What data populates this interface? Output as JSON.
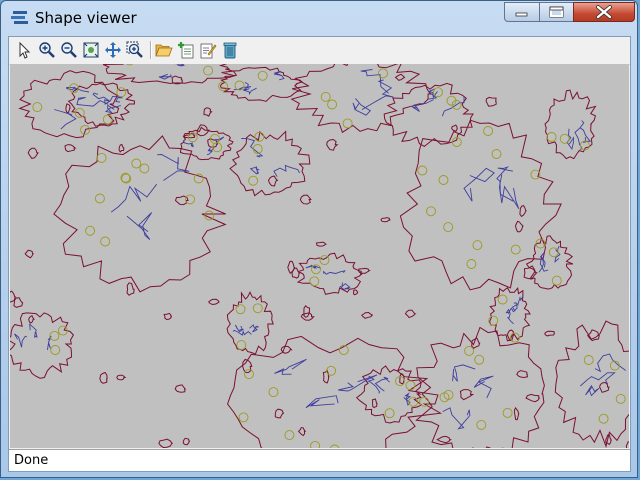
{
  "window": {
    "title": "Shape viewer"
  },
  "title_buttons": {
    "minimize_icon": "minimize-icon",
    "maximize_icon": "maximize-icon",
    "close_icon": "close-icon"
  },
  "toolbar": {
    "tools": [
      {
        "name": "select-tool",
        "icon": "arrow-cursor-icon"
      },
      {
        "name": "zoom-in-tool",
        "icon": "zoom-in-icon"
      },
      {
        "name": "zoom-out-tool",
        "icon": "zoom-out-icon"
      },
      {
        "name": "zoom-extent-tool",
        "icon": "zoom-extent-icon"
      },
      {
        "name": "pan-tool",
        "icon": "pan-icon"
      },
      {
        "name": "zoom-window-tool",
        "icon": "zoom-window-icon"
      },
      {
        "name": "open-shapefile-tool",
        "icon": "folder-open-icon"
      },
      {
        "name": "add-layer-tool",
        "icon": "add-layer-icon"
      },
      {
        "name": "edit-layer-tool",
        "icon": "edit-icon"
      },
      {
        "name": "delete-layer-tool",
        "icon": "trash-icon"
      }
    ]
  },
  "map": {
    "background_color": "#c0c0c0",
    "line_color": "#7a1030",
    "road_color": "#3f3f9f",
    "marker_color": "#9a9a20"
  },
  "status": {
    "text": "Done"
  }
}
